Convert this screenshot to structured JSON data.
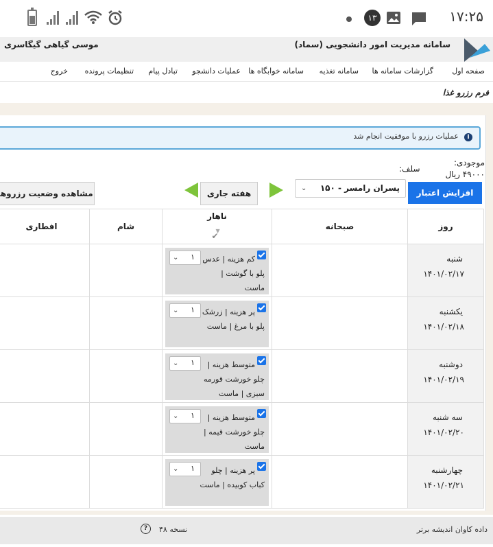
{
  "status_bar": {
    "time": "۱۷:۲۵",
    "notification_count": "۱۳"
  },
  "header": {
    "system_name": "سامانه مدیریت امور دانشجویی (سماد)",
    "user_name": "موسی  گیاهی گیگاسری"
  },
  "menu": {
    "items": [
      {
        "label": "صفحه اول"
      },
      {
        "label": "گزارشات سامانه ها"
      },
      {
        "label": "سامانه تغذیه"
      },
      {
        "label": "سامانه خوابگاه ها"
      },
      {
        "label": "عملیات دانشجو"
      },
      {
        "label": "تبادل پیام"
      },
      {
        "label": "تنظیمات پرونده"
      },
      {
        "label": "خروج"
      }
    ]
  },
  "form": {
    "title": "فرم رزرو غذا",
    "alert_message": "عملیات رزرو با موفقیت انجام شد",
    "balance_label": "موجودی:",
    "balance_value": "۴۹۰۰۰ ریال",
    "salaf_label": "سلف:",
    "credit_button": "افزایش اعتبار",
    "restaurant_selected": "پسران رامسر - ۱۵۰",
    "current_week_button": "هفته جاری",
    "view_status_button": "مشاهده وضعیت رزروها"
  },
  "table": {
    "headers": {
      "day": "روز",
      "breakfast": "صبحانه",
      "lunch": "ناهار",
      "dinner": "شام",
      "iftar": "افطاری"
    },
    "rows": [
      {
        "day": "شنبه",
        "date": "۱۴۰۱/۰۲/۱۷",
        "lunch": "کم هزینه | عدس پلو با گوشت | ماست",
        "qty": "۱"
      },
      {
        "day": "یکشنبه",
        "date": "۱۴۰۱/۰۲/۱۸",
        "lunch": "پر هزینه | زرشک پلو با مرغ | ماست",
        "qty": "۱"
      },
      {
        "day": "دوشنبه",
        "date": "۱۴۰۱/۰۲/۱۹",
        "lunch": "متوسط هزینه | چلو خورشت قورمه سبزی | ماست",
        "qty": "۱"
      },
      {
        "day": "سه شنبه",
        "date": "۱۴۰۱/۰۲/۲۰",
        "lunch": "متوسط هزینه | چلو خورشت قیمه | ماست",
        "qty": "۱"
      },
      {
        "day": "چهارشنبه",
        "date": "۱۴۰۱/۰۲/۲۱",
        "lunch": "پر هزینه | چلو کباب کوبیده | ماست",
        "qty": "۱"
      }
    ]
  },
  "footer": {
    "company": "داده کاوان اندیشه برتر",
    "version": "نسخه ۴۸"
  },
  "colors": {
    "primary_blue": "#1a73e8",
    "arrow_green": "#7ec43b",
    "alert_border": "#5aa7d8",
    "panel_bg": "#f5f0e8"
  }
}
